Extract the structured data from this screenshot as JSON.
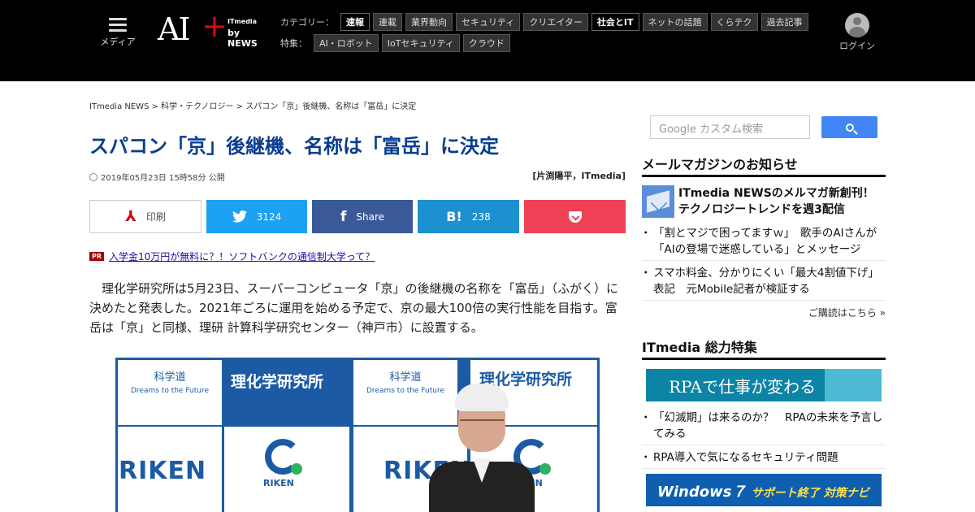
{
  "header": {
    "media_label": "メディア",
    "logo": {
      "ai": "AI",
      "plus": "+",
      "itmedia": "ITmedia",
      "news": "by NEWS"
    },
    "category_label": "カテゴリー：",
    "categories": [
      {
        "label": "速報",
        "active": true
      },
      {
        "label": "連載",
        "active": false
      },
      {
        "label": "業界動向",
        "active": false
      },
      {
        "label": "セキュリティ",
        "active": false
      },
      {
        "label": "クリエイター",
        "active": false
      },
      {
        "label": "社会とIT",
        "active": true
      },
      {
        "label": "ネットの話題",
        "active": false
      },
      {
        "label": "くらテク",
        "active": false
      },
      {
        "label": "過去記事",
        "active": false
      }
    ],
    "feature_label": "特集：",
    "features": [
      "AI・ロボット",
      "IoTセキュリティ",
      "クラウド"
    ],
    "login_label": "ログイン"
  },
  "article": {
    "breadcrumb": "ITmedia NEWS > 科学・テクノロジー > スパコン「京」後継機、名称は「富岳」に決定",
    "title": "スパコン「京」後継機、名称は「富岳」に決定",
    "published": "2019年05月23日 15時58分 公開",
    "author": "[片渕陽平，ITmedia]",
    "share": {
      "print_label": "印刷",
      "twitter_count": "3124",
      "facebook_label": "Share",
      "hatena_count": "238",
      "hatena_icon": "B!"
    },
    "pr_badge": "PR",
    "pr_link": "入学金10万円が無料に？！ソフトバンクの通信制大学って？",
    "body": "理化学研究所は5月23日、スーパーコンピュータ「京」の後継機の名称を「富岳」（ふがく）に決めたと発表した。2021年ごろに運用を始める予定で、京の最大100倍の実行性能を目指す。富岳は「京」と同様、理研 計算科学研究センター（神戸市）に設置する。",
    "photo": {
      "kagaku": "科学道",
      "dreams": "Dreams to the Future",
      "riken_jp": "理化学研究所",
      "riken_en": "RIKEN",
      "riken_logo_label": "RIKEN"
    }
  },
  "sidebar": {
    "search_placeholder": "Google カスタム検索",
    "mailmag_heading": "メールマガジンのお知らせ",
    "mailmag_feature": "ITmedia NEWSのメルマガ新創刊！ テクノロジートレンドを週3配信",
    "mailmag_items": [
      "「割とマジで困ってますｗ」　歌手のAIさんが「AIの登場で迷惑している」とメッセージ",
      "スマホ料金、分かりにくい「最大4割値下げ」表記　元Mobile記者が検証する"
    ],
    "more_link": "ご購読はこちら »",
    "special_heading": "ITmedia 総力特集",
    "rpa_banner": "RPAで仕事が変わる",
    "special_items": [
      "「幻滅期」は来るのか？　RPAの未来を予言してみる",
      "RPA導入で気になるセキュリティ問題"
    ],
    "win7_banner_main": "Windows７",
    "win7_banner_sub": "サポート終了 対策ナビ"
  },
  "colors": {
    "header_bg": "#000000",
    "title": "#0a3d8f",
    "twitter": "#1da1f2",
    "facebook": "#3b5998",
    "hatena": "#1d90d0",
    "pocket": "#ef4056",
    "google_search": "#4285f4"
  }
}
